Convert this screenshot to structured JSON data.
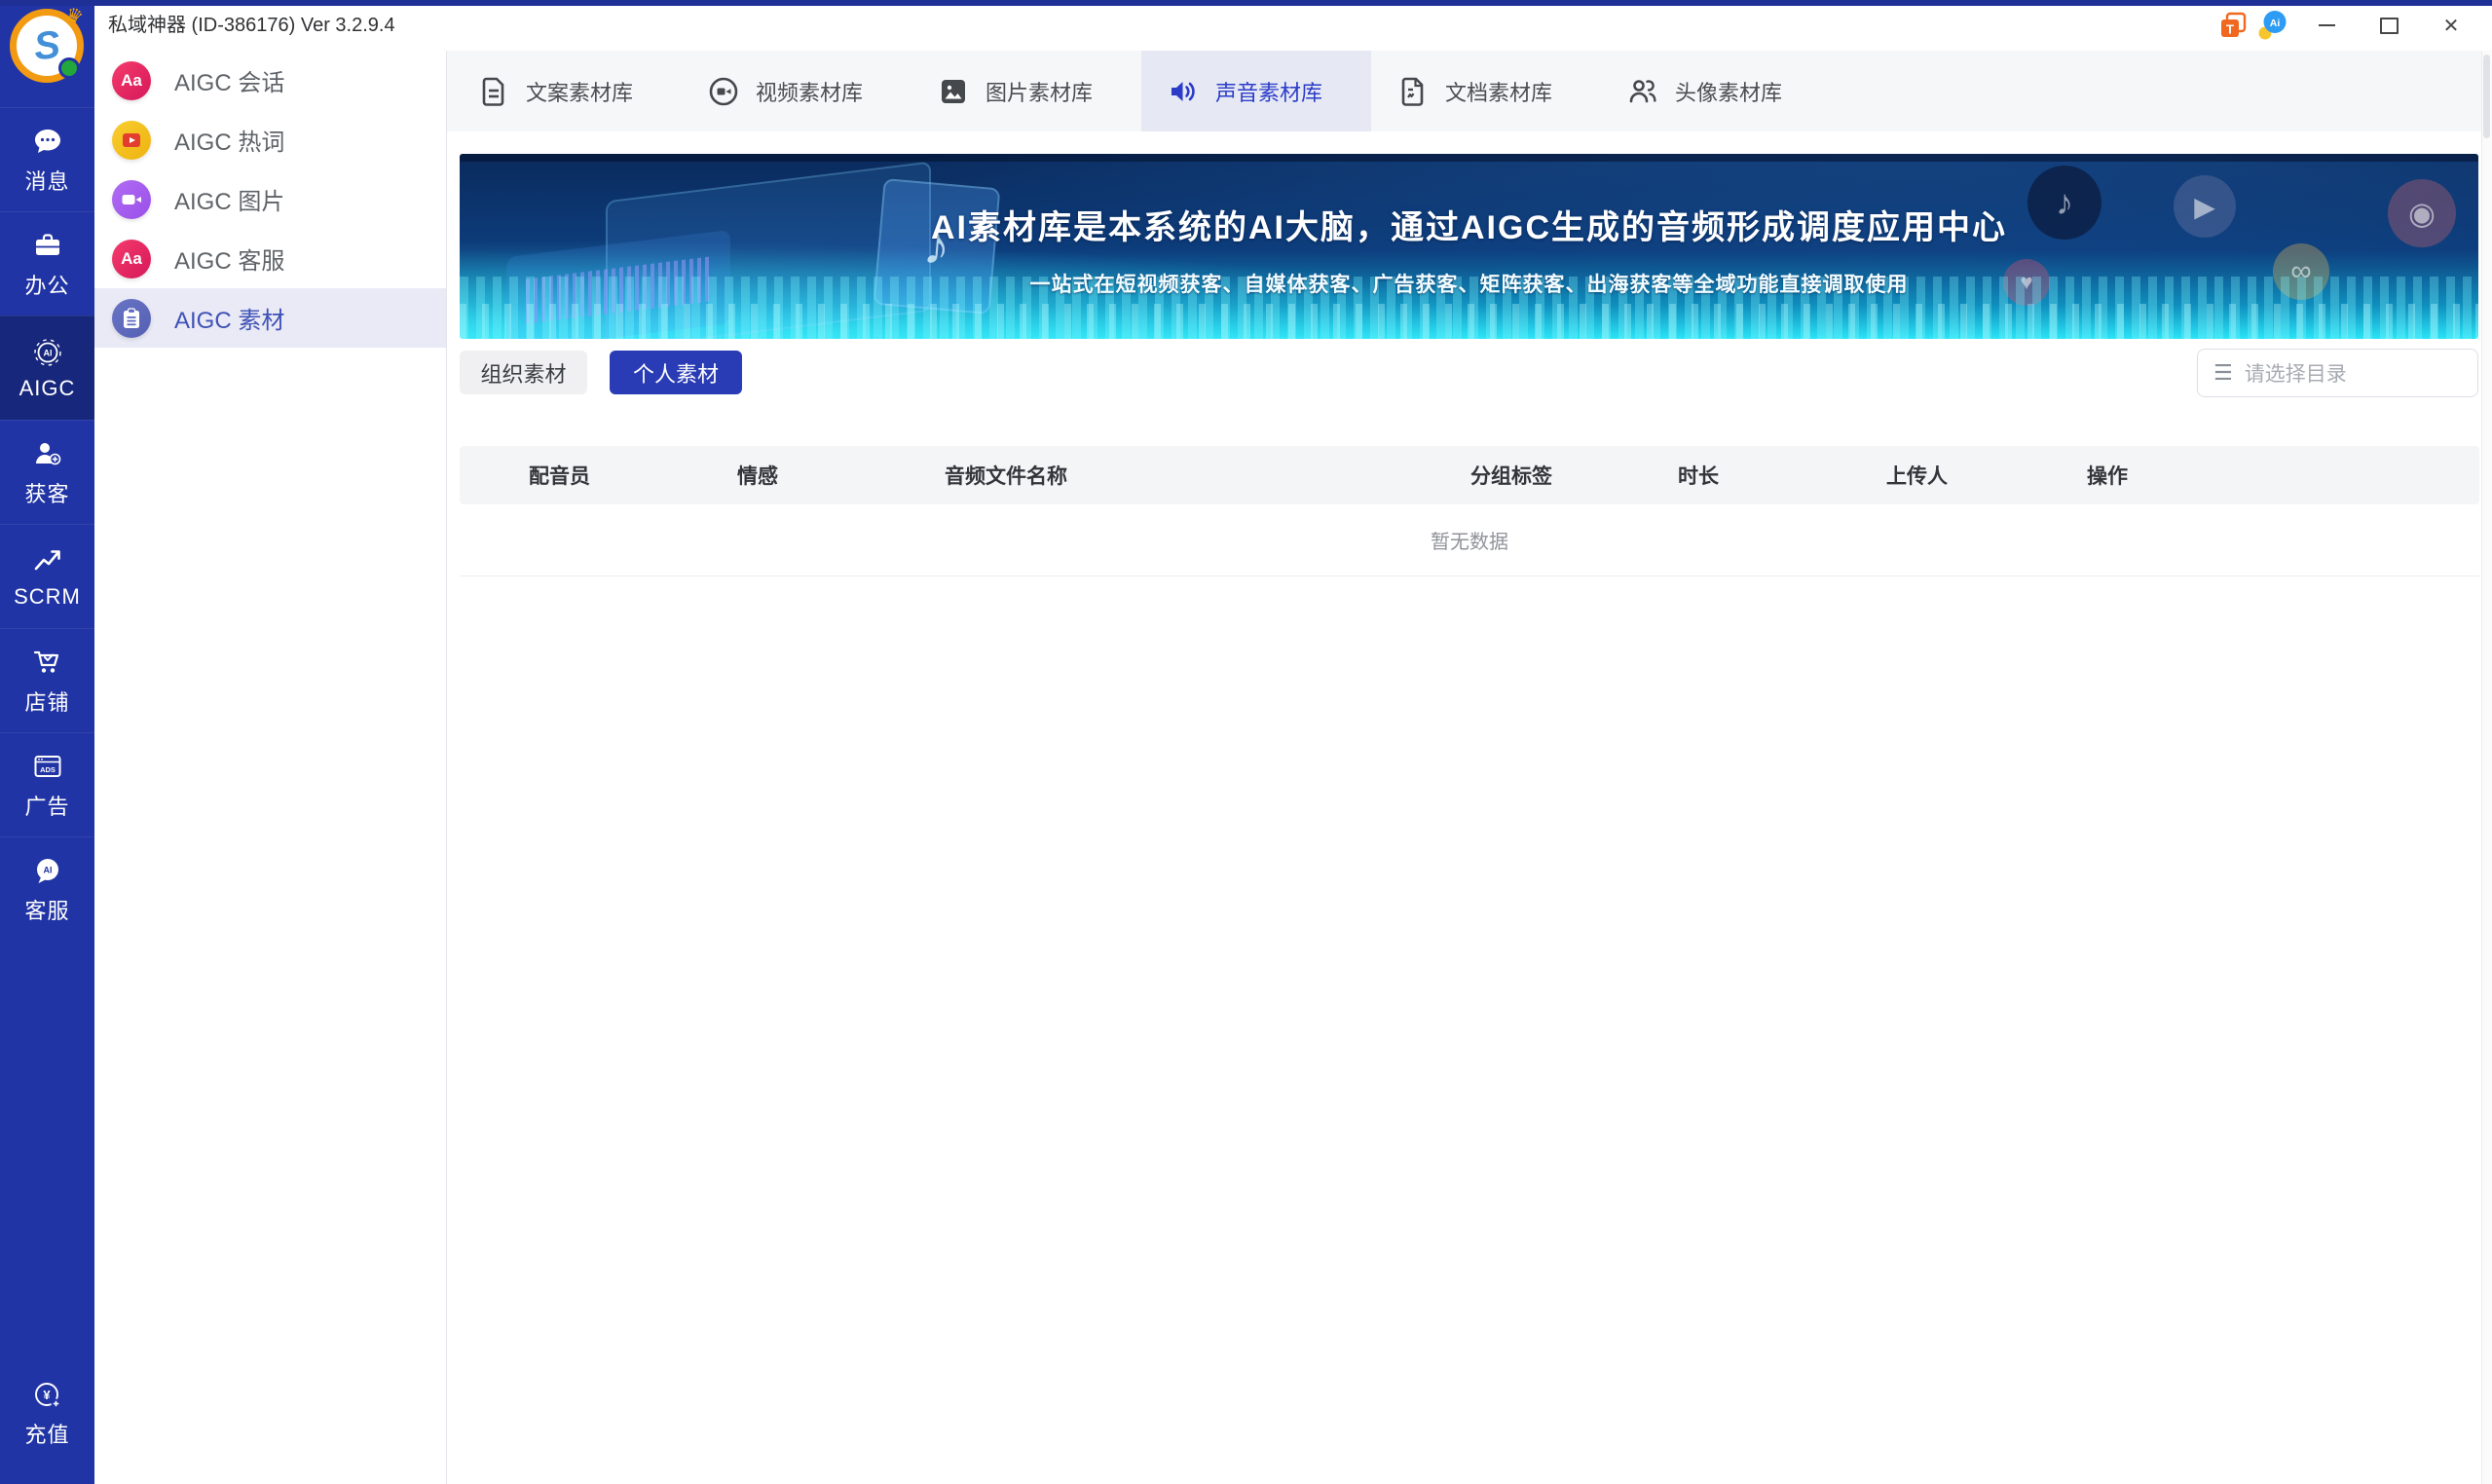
{
  "window": {
    "title": "私域神器 (ID-386176) Ver 3.2.9.4"
  },
  "glyphs": {
    "logo_letter": "S",
    "crown": "♛",
    "t_badge": "T",
    "ai_chat_badge": "Ai",
    "close": "✕",
    "aa": "Aa",
    "ai": "AI",
    "ads": "ADS",
    "yuan": "¥",
    "menu": "☰",
    "note": "♪",
    "play": "▶",
    "heart": "♥",
    "infinity": "∞",
    "disc": "◉"
  },
  "primary_sidebar": {
    "items": [
      {
        "label": "消息"
      },
      {
        "label": "办公"
      },
      {
        "label": "AIGC"
      },
      {
        "label": "获客"
      },
      {
        "label": "SCRM"
      },
      {
        "label": "店铺"
      },
      {
        "label": "广告"
      },
      {
        "label": "客服"
      }
    ],
    "bottom_item": {
      "label": "充值"
    }
  },
  "secondary_sidebar": {
    "items": [
      {
        "label": "AIGC 会话"
      },
      {
        "label": "AIGC 热词"
      },
      {
        "label": "AIGC 图片"
      },
      {
        "label": "AIGC 客服"
      },
      {
        "label": "AIGC 素材"
      }
    ]
  },
  "tabs": [
    {
      "label": "文案素材库"
    },
    {
      "label": "视频素材库"
    },
    {
      "label": "图片素材库"
    },
    {
      "label": "声音素材库"
    },
    {
      "label": "文档素材库"
    },
    {
      "label": "头像素材库"
    }
  ],
  "banner": {
    "title": "AI素材库是本系统的AI大脑，通过AIGC生成的音频形成调度应用中心",
    "subtitle": "一站式在短视频获客、自媒体获客、广告获客、矩阵获客、出海获客等全域功能直接调取使用"
  },
  "toolbar": {
    "org_label": "组织素材",
    "personal_label": "个人素材",
    "directory_placeholder": "请选择目录"
  },
  "table": {
    "headers": [
      "配音员",
      "情感",
      "音频文件名称",
      "分组标签",
      "时长",
      "上传人",
      "操作"
    ],
    "empty_text": "暂无数据"
  },
  "colors": {
    "sidebar": "#2134a5",
    "sidebar_active": "#17277c",
    "accent_blue": "#2b3cc8",
    "personal_button": "#2a3cb5",
    "tab_active_bg": "#e6e9f4",
    "banner_top": "#0a2a5c",
    "banner_bottom": "#2ae4f6"
  }
}
